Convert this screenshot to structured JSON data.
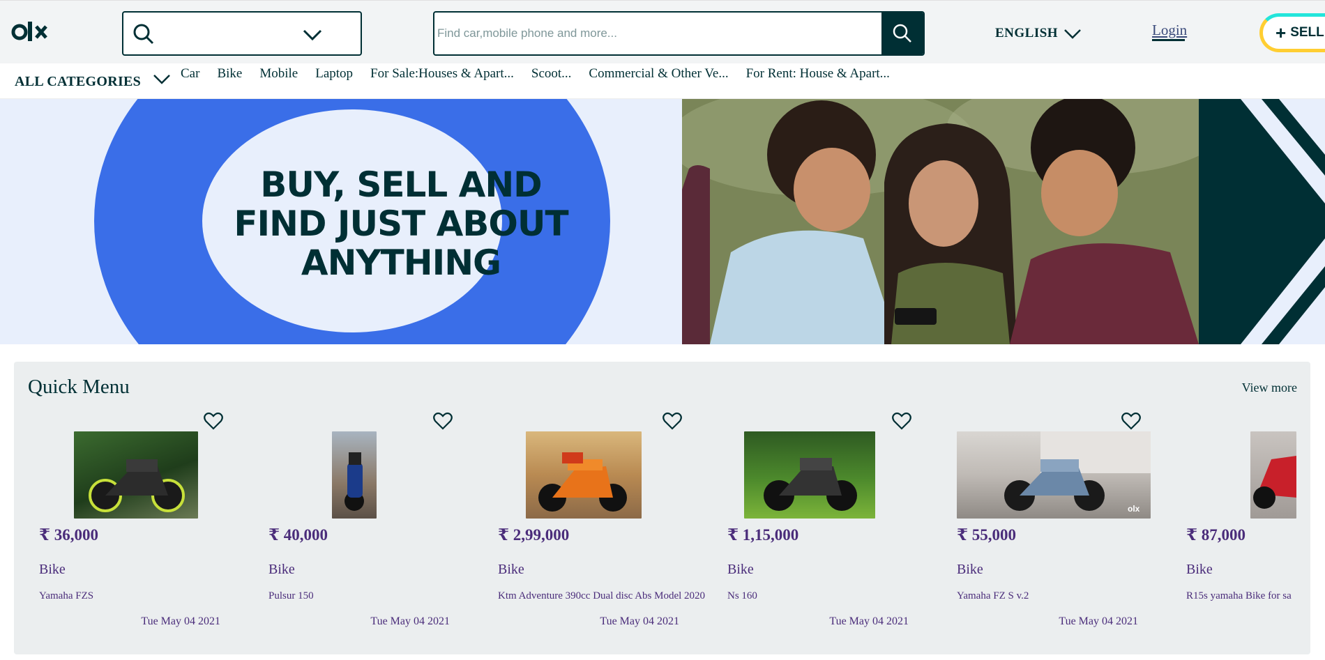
{
  "header": {
    "logo_alt": "olx-logo",
    "location_placeholder": "",
    "search_placeholder": "Find car,mobile phone and more...",
    "language": "ENGLISH",
    "login": "Login",
    "sell": "SELL"
  },
  "categories": {
    "all_label": "ALL CATEGORIES",
    "items": [
      "Car",
      "Bike",
      "Mobile",
      "Laptop",
      "For Sale:Houses & Apart...",
      "Scoot...",
      "Commercial & Other Ve...",
      "For Rent: House & Apart..."
    ]
  },
  "banner": {
    "line1": "BUY, SELL AND",
    "line2": "FIND JUST ABOUT",
    "line3": "ANYTHING"
  },
  "quick_menu": {
    "title": "Quick Menu",
    "view_more": "View more",
    "items": [
      {
        "price": "₹ 36,000",
        "category": "Bike",
        "name": "Yamaha FZS",
        "date": "Tue May 04 2021"
      },
      {
        "price": "₹ 40,000",
        "category": "Bike",
        "name": "Pulsur 150",
        "date": "Tue May 04 2021"
      },
      {
        "price": "₹ 2,99,000",
        "category": "Bike",
        "name": "Ktm Adventure 390cc Dual disc Abs Model 2020",
        "date": "Tue May 04 2021"
      },
      {
        "price": "₹ 1,15,000",
        "category": "Bike",
        "name": "Ns 160",
        "date": "Tue May 04 2021"
      },
      {
        "price": "₹ 55,000",
        "category": "Bike",
        "name": "Yamaha FZ S v.2",
        "date": "Tue May 04 2021"
      },
      {
        "price": "₹ 87,000",
        "category": "Bike",
        "name": "R15s yamaha Bike for sa",
        "date": ""
      }
    ]
  },
  "colors": {
    "brand_dark": "#002f34",
    "accent_teal": "#23e5db",
    "accent_yellow": "#ffce32",
    "banner_blue": "#3a6ee8",
    "price_purple": "#4a2c7a"
  }
}
